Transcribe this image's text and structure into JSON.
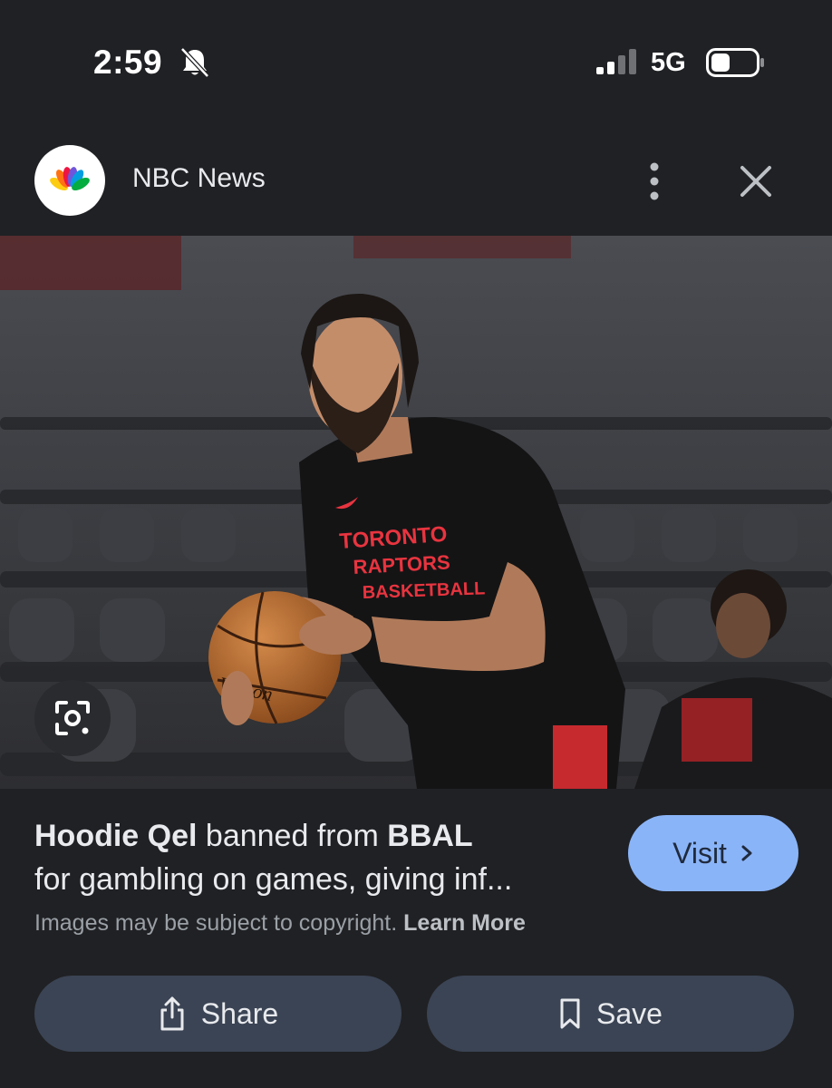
{
  "status_bar": {
    "time": "2:59",
    "network": "5G",
    "icons": [
      "bell-muted-icon",
      "signal-icon",
      "battery-icon"
    ]
  },
  "header": {
    "source_name": "NBC News",
    "logo_icon": "nbc-peacock-logo",
    "menu_icon": "more-vert-icon",
    "close_icon": "close-icon"
  },
  "image": {
    "description_icon": "lens-icon",
    "jersey_text": "TORONTO RAPTORS BASKETBALL",
    "ball_text": "Wilson"
  },
  "caption": {
    "name_bold": "Hoodie Qel",
    "mid_text": " banned from ",
    "org_bold": "BBAL",
    "line2": "for gambling on games, giving inf...",
    "copyright_text": "Images may be subject to copyright. ",
    "learn_more": "Learn More"
  },
  "buttons": {
    "visit": "Visit",
    "share": "Share",
    "save": "Save"
  },
  "colors": {
    "background": "#202124",
    "accent": "#8ab4f8",
    "action_button": "#3b4454",
    "jersey_red": "#e8343f"
  }
}
